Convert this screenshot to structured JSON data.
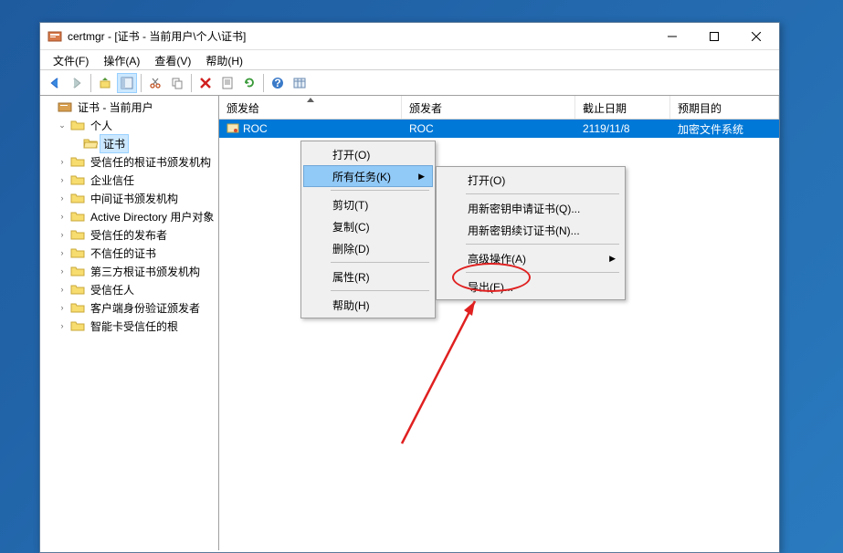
{
  "window": {
    "title": "certmgr - [证书 - 当前用户\\个人\\证书]"
  },
  "menubar": {
    "file": "文件(F)",
    "action": "操作(A)",
    "view": "查看(V)",
    "help": "帮助(H)"
  },
  "tree": {
    "root": "证书 - 当前用户",
    "personal": "个人",
    "certificates": "证书",
    "trusted_root": "受信任的根证书颁发机构",
    "enterprise_trust": "企业信任",
    "intermediate_ca": "中间证书颁发机构",
    "ad_user_object": "Active Directory 用户对象",
    "trusted_publishers": "受信任的发布者",
    "untrusted": "不信任的证书",
    "third_party_root": "第三方根证书颁发机构",
    "trusted_people": "受信任人",
    "client_auth_issuers": "客户端身份验证颁发者",
    "smartcard_trusted_roots": "智能卡受信任的根"
  },
  "list_headers": {
    "issued_to": "颁发给",
    "issued_by": "颁发者",
    "expiration": "截止日期",
    "purpose": "预期目的"
  },
  "list_rows": [
    {
      "issued_to": "ROC",
      "issued_by": "ROC",
      "expiration": "2119/11/8",
      "purpose": "加密文件系统"
    }
  ],
  "context_menu1": {
    "open": "打开(O)",
    "all_tasks": "所有任务(K)",
    "cut": "剪切(T)",
    "copy": "复制(C)",
    "delete": "删除(D)",
    "properties": "属性(R)",
    "help": "帮助(H)"
  },
  "context_menu2": {
    "open": "打开(O)",
    "request_new_key": "用新密钥申请证书(Q)...",
    "renew_new_key": "用新密钥续订证书(N)...",
    "advanced": "高级操作(A)",
    "export": "导出(E)..."
  }
}
